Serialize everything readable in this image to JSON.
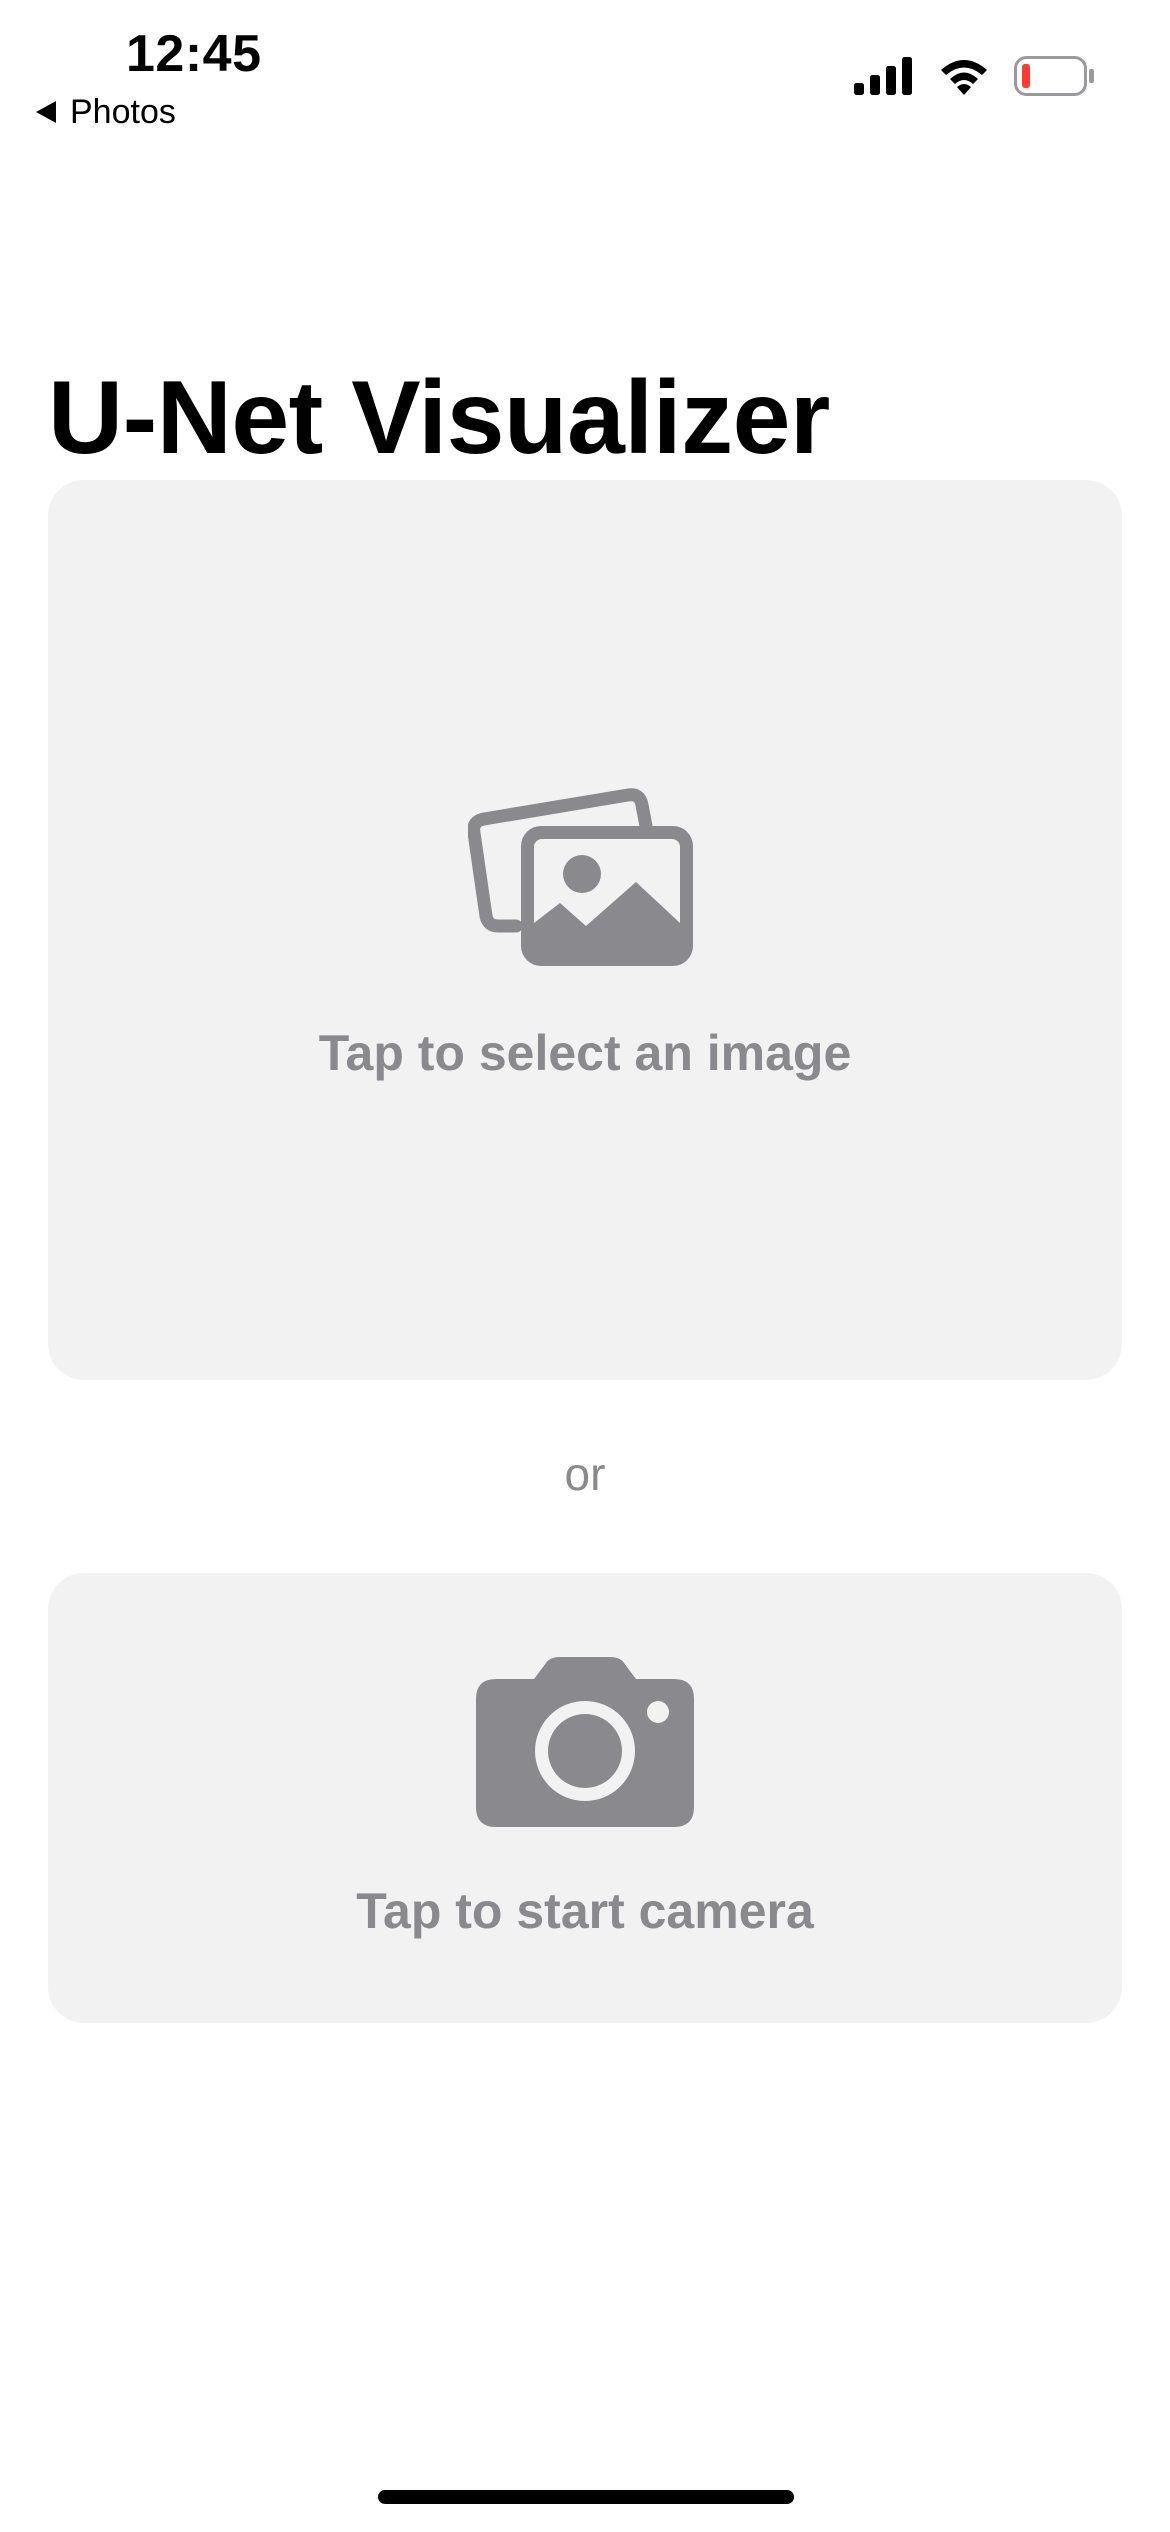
{
  "status_bar": {
    "time": "12:45",
    "back_label": "Photos",
    "battery_color": "#ff3b30"
  },
  "header": {
    "title": "U-Net Visualizer"
  },
  "image_picker": {
    "label": "Tap to select an image",
    "icon": "photo-stack-icon"
  },
  "separator": {
    "text": "or"
  },
  "camera_picker": {
    "label": "Tap to start camera",
    "icon": "camera-icon"
  },
  "colors": {
    "card_background": "#f2f2f2",
    "secondary_text": "#8a8a8e",
    "icon_gray": "#8a8a8e"
  }
}
